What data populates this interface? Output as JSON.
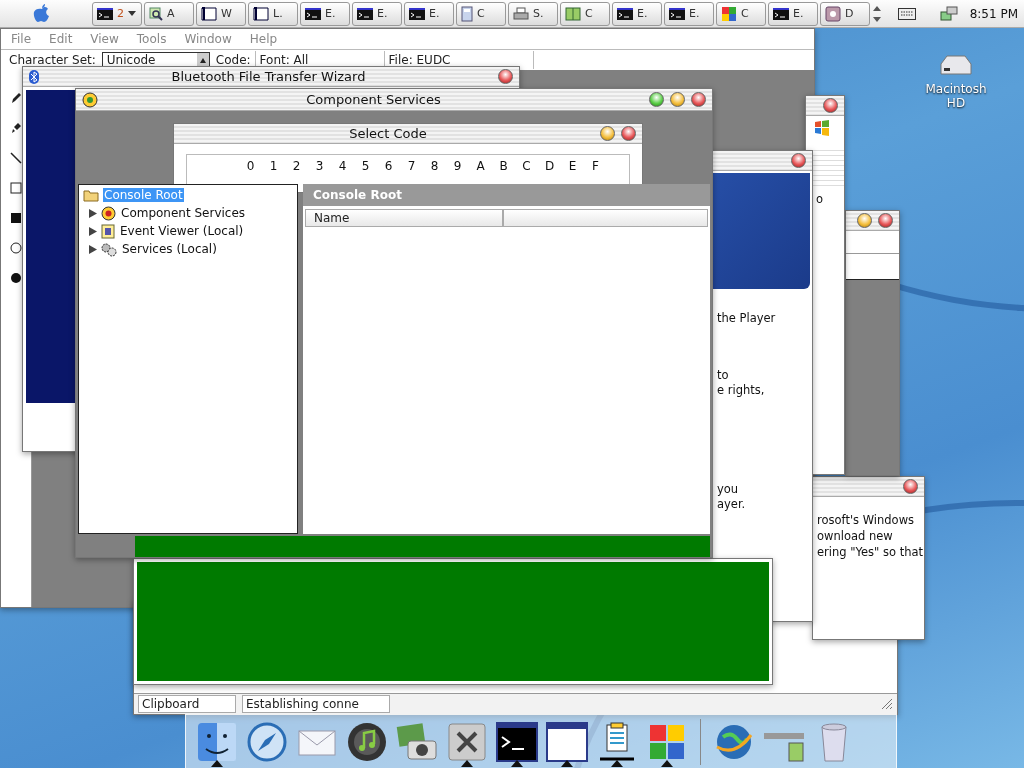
{
  "menu_bar": {
    "taskbar": [
      {
        "kind": "console",
        "label": "2",
        "menu": true
      },
      {
        "kind": "search",
        "label": "A",
        "menu": false
      },
      {
        "kind": "window",
        "label": "W",
        "menu": false
      },
      {
        "kind": "window",
        "label": "L.",
        "menu": false
      },
      {
        "kind": "console",
        "label": "E.",
        "menu": false
      },
      {
        "kind": "console",
        "label": "E.",
        "menu": false
      },
      {
        "kind": "console",
        "label": "E.",
        "menu": false
      },
      {
        "kind": "calculator",
        "label": "C",
        "menu": false
      },
      {
        "kind": "printer",
        "label": "S.",
        "menu": false
      },
      {
        "kind": "book",
        "label": "C",
        "menu": false
      },
      {
        "kind": "console",
        "label": "E.",
        "menu": false
      },
      {
        "kind": "console",
        "label": "E.",
        "menu": false
      },
      {
        "kind": "puzzle",
        "label": "C",
        "menu": false
      },
      {
        "kind": "console",
        "label": "E.",
        "menu": false
      },
      {
        "kind": "media",
        "label": "D",
        "menu": false
      }
    ],
    "clock": "8:51 PM"
  },
  "desktop_icons": [
    {
      "label": "Macintosh HD"
    }
  ],
  "character_editor": {
    "menu": [
      "File",
      "Edit",
      "View",
      "Tools",
      "Window",
      "Help"
    ],
    "character_set_label": "Character Set:",
    "character_set": "Unicode",
    "code_label": "Code:",
    "font": "Font: All",
    "file": "File: EUDC",
    "tools": [
      {
        "kind": "pencil"
      },
      {
        "kind": "brush"
      },
      {
        "kind": "line"
      },
      {
        "kind": "rectangle"
      },
      {
        "kind": "filled_rectangle"
      },
      {
        "kind": "ellipse"
      },
      {
        "kind": "filled_ellipse"
      }
    ]
  },
  "status_window": {
    "status": [
      "Clipboard",
      "Establishing conne"
    ]
  },
  "update_dialog": {
    "lines": [
      "rosoft's Windows",
      "ownload new",
      "ering \"Yes\" so that"
    ]
  },
  "xp_window": {
    "text": "o"
  },
  "media_wizard": {
    "paragraphs": [
      [
        "the Player"
      ],
      [
        "to",
        "e rights,"
      ],
      [
        "you",
        "ayer."
      ]
    ]
  },
  "bluetooth_wizard": {
    "title": "Bluetooth File Transfer Wizard"
  },
  "component_services": {
    "title": "Component Services",
    "select_code": {
      "title": "Select Code",
      "columns": [
        "0",
        "1",
        "2",
        "3",
        "4",
        "5",
        "6",
        "7",
        "8",
        "9",
        "A",
        "B",
        "C",
        "D",
        "E",
        "F"
      ]
    },
    "tree": {
      "label": "Console Root",
      "kind": "folder",
      "selected": true,
      "children": [
        {
          "label": "Component Services",
          "kind": "component",
          "selected": false,
          "expanded": false
        },
        {
          "label": "Event Viewer (Local)",
          "kind": "event",
          "selected": false,
          "expanded": false
        },
        {
          "label": "Services (Local)",
          "kind": "gears",
          "selected": false,
          "expanded": false
        }
      ]
    },
    "header": "Console Root",
    "columns": [
      "Name"
    ]
  },
  "dock": {
    "items": [
      {
        "kind": "finder",
        "running": true
      },
      {
        "kind": "safari",
        "running": false
      },
      {
        "kind": "mail",
        "running": false
      },
      {
        "kind": "music",
        "running": false
      },
      {
        "kind": "photo",
        "running": false
      },
      {
        "kind": "tools",
        "running": true
      },
      {
        "kind": "console",
        "running": true
      },
      {
        "kind": "window",
        "running": true
      },
      {
        "kind": "clipboard",
        "running": true
      },
      {
        "kind": "puzzle",
        "running": true
      },
      {
        "kind": "separator"
      },
      {
        "kind": "globe",
        "running": false
      },
      {
        "kind": "thumbnail",
        "running": false
      },
      {
        "kind": "trash",
        "running": false
      }
    ]
  }
}
